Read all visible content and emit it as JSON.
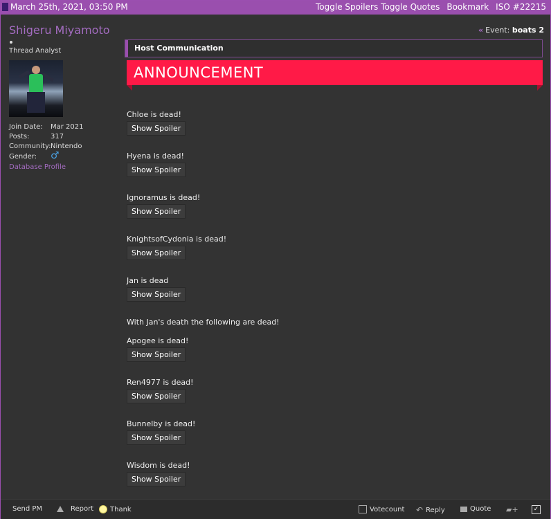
{
  "topbar": {
    "date": "March 25th, 2021, 03:50 PM",
    "toggle_spoilers": "Toggle Spoilers",
    "toggle_quotes": "Toggle Quotes",
    "bookmark": "Bookmark",
    "iso": "ISO",
    "post_number": "#22215"
  },
  "user": {
    "name": "Shigeru Miyamoto",
    "title": "Thread Analyst",
    "join_label": "Join Date:",
    "join_value": "Mar 2021",
    "posts_label": "Posts:",
    "posts_value": "317",
    "community_label": "Community:",
    "community_value": "Nintendo",
    "gender_label": "Gender:",
    "gender_icon": "male-symbol",
    "database_profile": "Database Profile"
  },
  "post": {
    "event_label": "Event:",
    "event_value": "boats 2",
    "host_label": "Host Communication",
    "announcement": "ANNOUNCEMENT",
    "entries": [
      {
        "text": "Chloe is dead!",
        "button": "Show Spoiler"
      },
      {
        "text": "Hyena is dead!",
        "button": "Show Spoiler"
      },
      {
        "text": "Ignoramus is dead!",
        "button": "Show Spoiler"
      },
      {
        "text": "KnightsofCydonia is dead!",
        "button": "Show Spoiler"
      },
      {
        "text": "Jan is dead",
        "button": "Show Spoiler"
      },
      {
        "text": "Apogee is dead!",
        "button": "Show Spoiler"
      },
      {
        "text": "Ren4977 is dead!",
        "button": "Show Spoiler"
      },
      {
        "text": "Bunnelby is dead!",
        "button": "Show Spoiler"
      },
      {
        "text": "Wisdom is dead!",
        "button": "Show Spoiler"
      }
    ],
    "jan_note": "With Jan's death the following are dead!"
  },
  "footer": {
    "send_pm": "Send PM",
    "report": "Report",
    "thank": "Thank",
    "votecount": "Votecount",
    "reply": "Reply",
    "quote": "Quote"
  },
  "colors": {
    "accent": "#9a4fae",
    "announcement": "#ff1a47",
    "username": "#a36cc0"
  }
}
